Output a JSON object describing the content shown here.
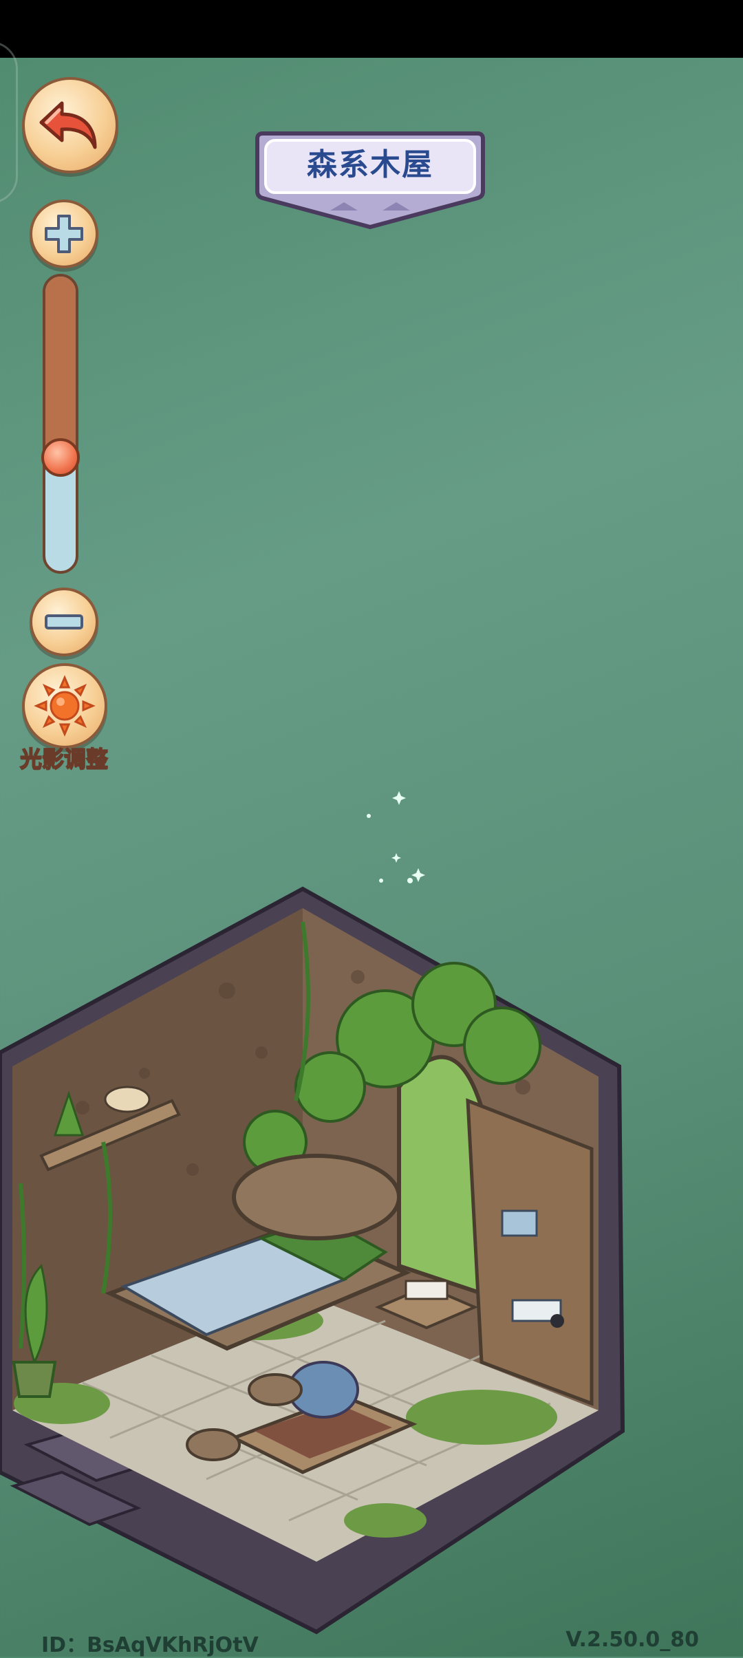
{
  "header": {
    "title": "森系木屋"
  },
  "controls": {
    "back_icon": "back-arrow-icon",
    "zoom_in_icon": "plus-icon",
    "zoom_out_icon": "minus-icon",
    "zoom_level": 0.37,
    "light_adjust_icon": "sun-icon",
    "light_adjust_label": "光影调整"
  },
  "footer": {
    "id_label": "ID：BsAqVKhRjOtV",
    "version": "V.2.50.0_80"
  },
  "colors": {
    "background": "#5a9078",
    "button_face": "#f7cf95",
    "button_border": "#8a5a3a",
    "slider_upper": "#b8714a",
    "slider_lower": "#b9dbe6",
    "slider_thumb": "#f0734d",
    "title_text": "#2a4a8f"
  }
}
